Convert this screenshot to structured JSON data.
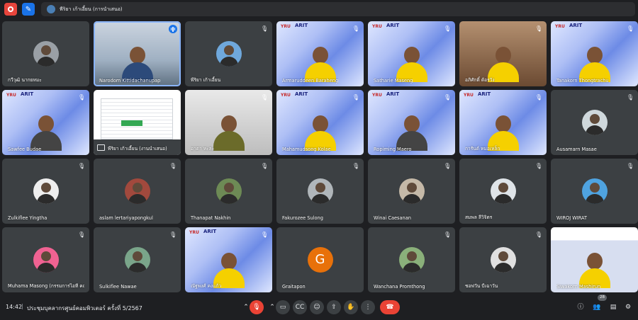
{
  "presenter_bar": {
    "name": "พีริยา เก้าเอี้ยน (การนำเสนอ)"
  },
  "tiles": [
    {
      "name": "กวีวุฒิ นากยหมะ"
    },
    {
      "name": "Narodom Kittidachanupap"
    },
    {
      "name": "พีริยา เก้าเอี้ยน"
    },
    {
      "name": "Armaruddeen Baraheng"
    },
    {
      "name": "Satharie Maseng"
    },
    {
      "name": "อภิศักดิ์ ด้อรวัง"
    },
    {
      "name": "Tanakorn Thongtrachu"
    },
    {
      "name": "Sawfee Budae"
    },
    {
      "name": "พีริยา เก้าเอี้ยน (งานนำเสนอ)"
    },
    {
      "name": "อาตา หะละ"
    },
    {
      "name": "Mahamudsong Kolae"
    },
    {
      "name": "Ropiming Maero"
    },
    {
      "name": "การันต์ หมอเหล็ก"
    },
    {
      "name": "Ausamarn Masae"
    },
    {
      "name": "Zulkiflee Yingtha"
    },
    {
      "name": "aslam lertariyapongkul"
    },
    {
      "name": "Thanapat Nakhin"
    },
    {
      "name": "Fakurozee Sulong"
    },
    {
      "name": "Winai Caesanan"
    },
    {
      "name": "สมพล ลีวิจิตร"
    },
    {
      "name": "WIROJ WIRAT"
    },
    {
      "name": "Muhama Masong (กรรมการไอที คณ..."
    },
    {
      "name": "Sulkiflee Nawae"
    },
    {
      "name": "ณัฐพงศ์ คงแก้ว"
    },
    {
      "name": "Graitapon",
      "initial": "G"
    },
    {
      "name": "Wanchana Promthong"
    },
    {
      "name": "ชอฟวัน บีเฉาวัน"
    },
    {
      "name": "Siwakorn Mashirun"
    }
  ],
  "bottom_bar": {
    "time": "14:42",
    "separator": "|",
    "meeting_title": "ประชุมบุคลากรศูนย์คอมพิวเตอร์ ครั้งที่ 5/2567",
    "participant_count": "28"
  },
  "icons": {
    "mic_off": "mic-off-icon",
    "record": "record-icon",
    "whiteboard": "whiteboard-icon"
  },
  "colors": {
    "end_call": "#ea4335",
    "accent": "#1a73e8",
    "tile": "#3c4043"
  }
}
